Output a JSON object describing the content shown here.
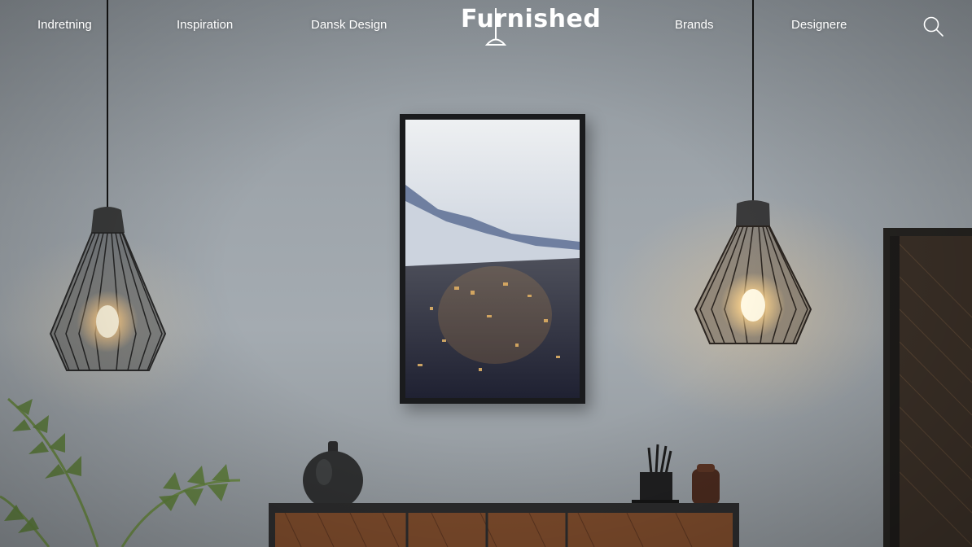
{
  "nav": {
    "left_items": [
      {
        "label": "Indretning"
      },
      {
        "label": "Inspiration"
      },
      {
        "label": "Dansk Design"
      }
    ],
    "logo_text": "Furnished",
    "right_items": [
      {
        "label": "Brands"
      },
      {
        "label": "Designere"
      }
    ],
    "search_icon": "search-icon"
  },
  "colors": {
    "wall": "#9ea5ab",
    "nav_text": "#ffffff",
    "lamp_glow": "#e7c48f"
  }
}
